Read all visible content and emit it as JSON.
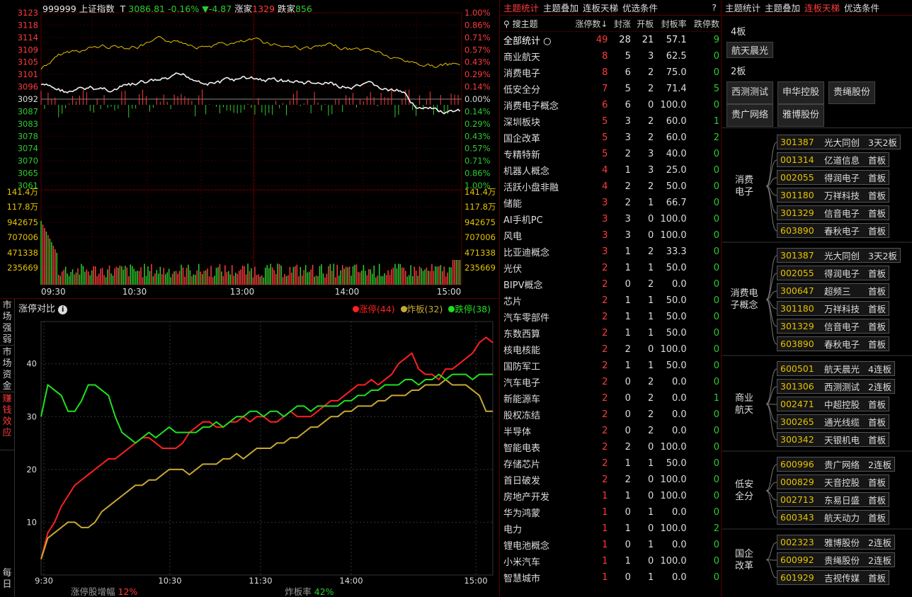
{
  "index_header": {
    "code": "999999",
    "name": "上证指数",
    "mark": "T",
    "price": "3086.81",
    "pct": "-0.16%",
    "arrow": "▼",
    "change": "-4.87",
    "up_label": "涨家",
    "up_count": "1329",
    "down_label": "跌家",
    "down_count": "856"
  },
  "price_axis": {
    "left": [
      "3123",
      "3118",
      "3114",
      "3109",
      "3105",
      "3101",
      "3096",
      "3092",
      "3087",
      "3083",
      "3078",
      "3074",
      "3070",
      "3065",
      "3061"
    ],
    "right": [
      "1.00%",
      "0.86%",
      "0.71%",
      "0.57%",
      "0.43%",
      "0.29%",
      "0.14%",
      "0.00%",
      "0.14%",
      "0.29%",
      "0.43%",
      "0.57%",
      "0.71%",
      "0.86%",
      "1.00%"
    ]
  },
  "volume_axis": [
    "141.4万",
    "117.8万",
    "942675",
    "707006",
    "471338",
    "235669"
  ],
  "time_axis": [
    "09:30",
    "10:30",
    "13:00",
    "14:00",
    "15:00"
  ],
  "compare": {
    "title": "涨停对比",
    "legend": [
      {
        "name": "涨停(44)",
        "color": "#ff2020"
      },
      {
        "name": "炸板(32)",
        "color": "#c8a832"
      },
      {
        "name": "跌停(38)",
        "color": "#20e020"
      }
    ],
    "footer": {
      "inc_label": "涨停股增幅",
      "inc_val": "12%",
      "rate_label": "炸板率",
      "rate_val": "42%"
    }
  },
  "compare_chart": {
    "type": "line",
    "x": [
      "9:30",
      "10:30",
      "11:30",
      "14:00",
      "15:00"
    ],
    "yticks": [
      "10",
      "20",
      "30",
      "40"
    ],
    "ylim": [
      0,
      48
    ],
    "series": [
      {
        "name": "涨停(44)",
        "color": "#ff2020",
        "values": [
          3,
          8,
          10,
          13,
          15,
          17,
          18,
          19,
          20,
          21,
          22,
          22,
          23,
          24,
          25,
          26,
          26,
          25,
          24,
          24,
          24,
          25,
          27,
          28,
          29,
          29,
          28,
          28,
          29,
          29,
          30,
          29,
          30,
          30,
          29,
          29,
          30,
          31,
          30,
          30,
          30,
          31,
          32,
          33,
          33,
          34,
          35,
          36,
          36,
          37,
          36,
          37,
          38,
          40,
          41,
          42,
          39,
          38,
          38,
          37,
          39,
          39,
          40,
          41,
          42,
          44,
          45,
          44
        ]
      },
      {
        "name": "炸板(32)",
        "color": "#c8a832",
        "values": [
          3,
          7,
          8,
          9,
          10,
          10,
          9,
          9,
          10,
          12,
          13,
          14,
          15,
          16,
          17,
          17,
          18,
          18,
          19,
          20,
          20,
          20,
          19,
          20,
          21,
          21,
          21,
          22,
          22,
          23,
          22,
          23,
          24,
          24,
          24,
          25,
          25,
          26,
          26,
          27,
          28,
          28,
          29,
          30,
          30,
          31,
          31,
          32,
          32,
          32,
          33,
          33,
          34,
          34,
          34,
          35,
          35,
          36,
          36,
          36,
          37,
          36,
          36,
          36,
          35,
          34,
          31,
          31
        ]
      },
      {
        "name": "跌停(38)",
        "color": "#20e020",
        "values": [
          30,
          36,
          35,
          34,
          31,
          31,
          33,
          36,
          36,
          35,
          34,
          30,
          27,
          26,
          25,
          26,
          27,
          26,
          27,
          28,
          27,
          27,
          27,
          27,
          28,
          28,
          29,
          28,
          29,
          30,
          30,
          31,
          31,
          30,
          31,
          31,
          30,
          31,
          32,
          32,
          31,
          32,
          32,
          32,
          32,
          33,
          33,
          34,
          34,
          35,
          35,
          36,
          36,
          36,
          37,
          37,
          36,
          37,
          37,
          38,
          37,
          38,
          38,
          38,
          37,
          38,
          38,
          38
        ]
      }
    ]
  },
  "vtabs": [
    {
      "label": "市场强弱",
      "active": false
    },
    {
      "label": "市场资金",
      "active": false
    },
    {
      "label": "赚钱效应",
      "active": true
    },
    {
      "label": "每日",
      "active": false
    }
  ],
  "mid_tabs": [
    "主题统计",
    "主题叠加",
    "连板天梯",
    "优选条件"
  ],
  "mid_help": "?",
  "table": {
    "search": "搜主题",
    "headers": [
      "涨停数↓",
      "封涨",
      "开板",
      "封板率",
      "跌停数"
    ],
    "summary": {
      "name": "全部统计",
      "zt": "49",
      "fz": "28",
      "kb": "21",
      "rate": "57.1",
      "dt": "9"
    },
    "rows": [
      [
        "商业航天",
        "8",
        "5",
        "3",
        "62.5",
        "0"
      ],
      [
        "消费电子",
        "8",
        "6",
        "2",
        "75.0",
        "0"
      ],
      [
        "低安全分",
        "7",
        "5",
        "2",
        "71.4",
        "5"
      ],
      [
        "消费电子概念",
        "6",
        "6",
        "0",
        "100.0",
        "0"
      ],
      [
        "深圳板块",
        "5",
        "3",
        "2",
        "60.0",
        "1"
      ],
      [
        "国企改革",
        "5",
        "3",
        "2",
        "60.0",
        "2"
      ],
      [
        "专精特新",
        "5",
        "2",
        "3",
        "40.0",
        "0"
      ],
      [
        "机器人概念",
        "4",
        "1",
        "3",
        "25.0",
        "0"
      ],
      [
        "活跃小盘非融",
        "4",
        "2",
        "2",
        "50.0",
        "0"
      ],
      [
        "储能",
        "3",
        "2",
        "1",
        "66.7",
        "0"
      ],
      [
        "AI手机PC",
        "3",
        "3",
        "0",
        "100.0",
        "0"
      ],
      [
        "风电",
        "3",
        "3",
        "0",
        "100.0",
        "0"
      ],
      [
        "比亚迪概念",
        "3",
        "1",
        "2",
        "33.3",
        "0"
      ],
      [
        "光伏",
        "2",
        "1",
        "1",
        "50.0",
        "0"
      ],
      [
        "BIPV概念",
        "2",
        "0",
        "2",
        "0.0",
        "0"
      ],
      [
        "芯片",
        "2",
        "1",
        "1",
        "50.0",
        "0"
      ],
      [
        "汽车零部件",
        "2",
        "1",
        "1",
        "50.0",
        "0"
      ],
      [
        "东数西算",
        "2",
        "1",
        "1",
        "50.0",
        "0"
      ],
      [
        "核电核能",
        "2",
        "2",
        "0",
        "100.0",
        "0"
      ],
      [
        "国防军工",
        "2",
        "1",
        "1",
        "50.0",
        "0"
      ],
      [
        "汽车电子",
        "2",
        "0",
        "2",
        "0.0",
        "0"
      ],
      [
        "新能源车",
        "2",
        "0",
        "2",
        "0.0",
        "1"
      ],
      [
        "股权冻结",
        "2",
        "0",
        "2",
        "0.0",
        "0"
      ],
      [
        "半导体",
        "2",
        "0",
        "2",
        "0.0",
        "0"
      ],
      [
        "智能电表",
        "2",
        "2",
        "0",
        "100.0",
        "0"
      ],
      [
        "存储芯片",
        "2",
        "1",
        "1",
        "50.0",
        "0"
      ],
      [
        "首日破发",
        "2",
        "2",
        "0",
        "100.0",
        "0"
      ],
      [
        "房地产开发",
        "1",
        "1",
        "0",
        "100.0",
        "0"
      ],
      [
        "华为鸿蒙",
        "1",
        "0",
        "1",
        "0.0",
        "0"
      ],
      [
        "电力",
        "1",
        "1",
        "0",
        "100.0",
        "2"
      ],
      [
        "锂电池概念",
        "1",
        "0",
        "1",
        "0.0",
        "0"
      ],
      [
        "小米汽车",
        "1",
        "1",
        "0",
        "100.0",
        "0"
      ],
      [
        "智慧城市",
        "1",
        "0",
        "1",
        "0.0",
        "0"
      ]
    ]
  },
  "right_tabs": [
    "主题统计",
    "主题叠加",
    "连板天梯",
    "优选条件"
  ],
  "ladder": [
    {
      "level": "4板",
      "stocks": [
        "航天晨光"
      ]
    },
    {
      "level": "2板",
      "stocks": [
        "西测测试",
        "申华控股",
        "贵绳股份",
        "贵广网络",
        "雅博股份"
      ]
    }
  ],
  "groups": [
    {
      "name": "消费\n电子",
      "stocks": [
        [
          "301387",
          "光大同创",
          "3天2板"
        ],
        [
          "001314",
          "亿道信息",
          "首板"
        ],
        [
          "002055",
          "得润电子",
          "首板"
        ],
        [
          "301180",
          "万祥科技",
          "首板"
        ],
        [
          "301329",
          "信音电子",
          "首板"
        ],
        [
          "603890",
          "春秋电子",
          "首板"
        ]
      ]
    },
    {
      "name": "消费电\n子概念",
      "stocks": [
        [
          "301387",
          "光大同创",
          "3天2板"
        ],
        [
          "002055",
          "得润电子",
          "首板"
        ],
        [
          "300647",
          "超频三",
          "首板"
        ],
        [
          "301180",
          "万祥科技",
          "首板"
        ],
        [
          "301329",
          "信音电子",
          "首板"
        ],
        [
          "603890",
          "春秋电子",
          "首板"
        ]
      ]
    },
    {
      "name": "商业\n航天",
      "stocks": [
        [
          "600501",
          "航天晨光",
          "4连板"
        ],
        [
          "301306",
          "西测测试",
          "2连板"
        ],
        [
          "002471",
          "中超控股",
          "首板"
        ],
        [
          "300265",
          "通光线缆",
          "首板"
        ],
        [
          "300342",
          "天银机电",
          "首板"
        ]
      ]
    },
    {
      "name": "低安\n全分",
      "stocks": [
        [
          "600996",
          "贵广网络",
          "2连板"
        ],
        [
          "000829",
          "天音控股",
          "首板"
        ],
        [
          "002713",
          "东易日盛",
          "首板"
        ],
        [
          "600343",
          "航天动力",
          "首板"
        ]
      ]
    },
    {
      "name": "国企\n改革",
      "stocks": [
        [
          "002323",
          "雅博股份",
          "2连板"
        ],
        [
          "600992",
          "贵绳股份",
          "2连板"
        ],
        [
          "601929",
          "吉视传媒",
          "首板"
        ]
      ]
    }
  ]
}
